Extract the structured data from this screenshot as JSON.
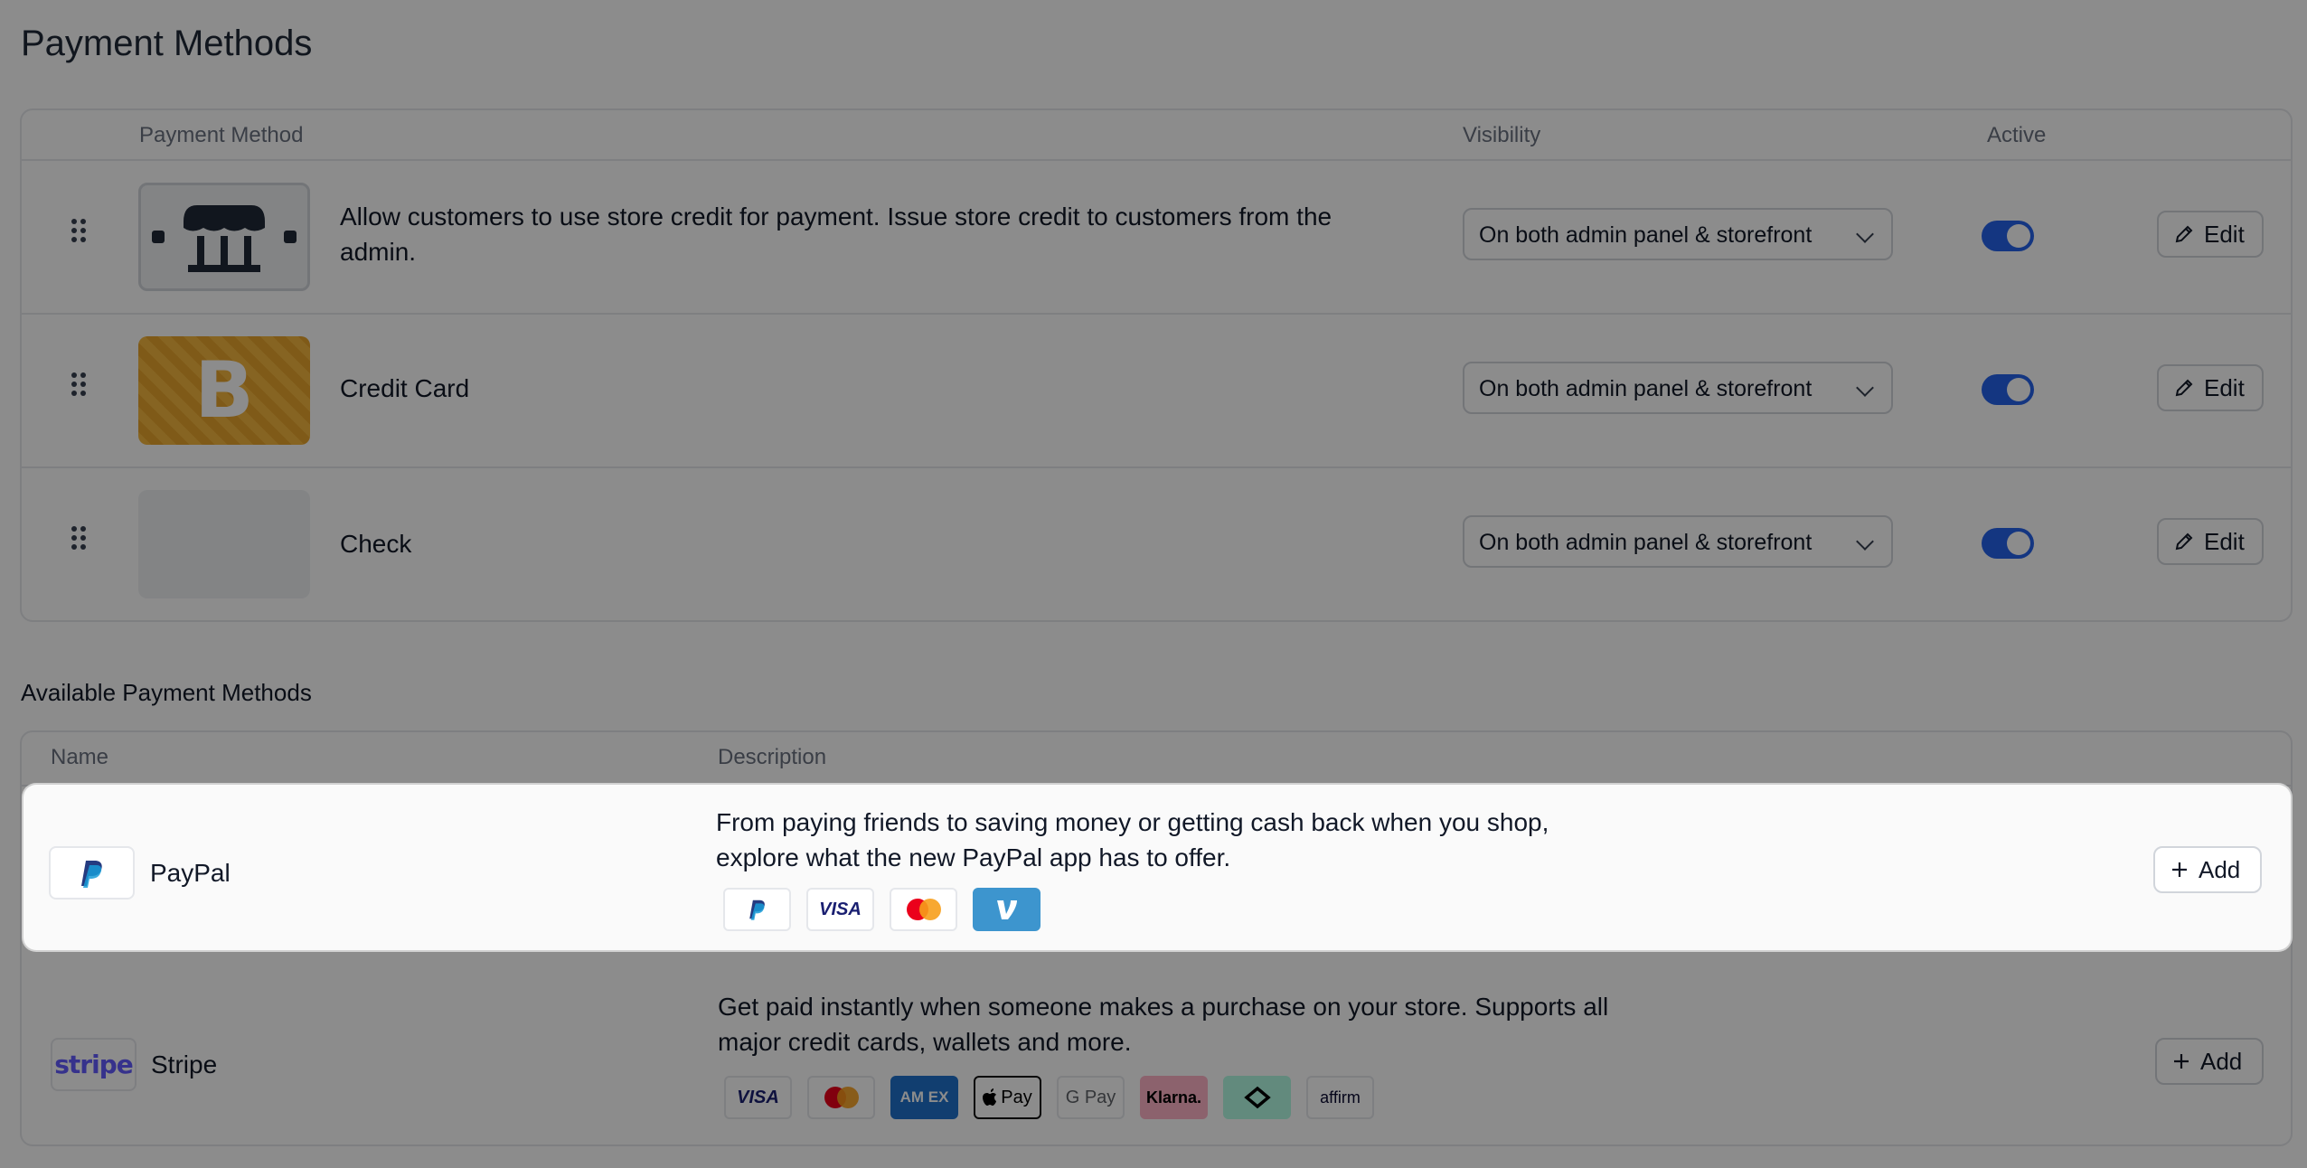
{
  "page_title": "Payment Methods",
  "methods_table": {
    "headers": {
      "method": "Payment Method",
      "visibility": "Visibility",
      "active": "Active"
    },
    "rows": [
      {
        "description": "Allow customers to use store credit for payment. Issue store credit to customers from the admin.",
        "logo": "store-icon",
        "visibility": "On both admin panel & storefront",
        "active": true,
        "edit_label": "Edit"
      },
      {
        "description": "Credit Card",
        "logo": "bold-b-logo",
        "logo_text": "B",
        "visibility": "On both admin panel & storefront",
        "active": true,
        "edit_label": "Edit"
      },
      {
        "description": "Check",
        "logo": "blank-logo",
        "visibility": "On both admin panel & storefront",
        "active": true,
        "edit_label": "Edit"
      }
    ]
  },
  "available": {
    "title": "Available Payment Methods",
    "headers": {
      "name": "Name",
      "description": "Description"
    },
    "rows": [
      {
        "name": "PayPal",
        "logo": "paypal-logo",
        "description": "From paying friends to saving money or getting cash back when you shop, explore what the new PayPal app has to offer.",
        "add_label": "Add",
        "brands": [
          "paypal",
          "visa",
          "mastercard",
          "venmo"
        ],
        "visa_text": "VISA"
      },
      {
        "name": "Stripe",
        "logo_text": "stripe",
        "description": "Get paid instantly when someone makes a purchase on your store. Supports all major credit cards, wallets and more.",
        "add_label": "Add",
        "brands": [
          "visa",
          "mastercard",
          "amex",
          "apple-pay",
          "google-pay",
          "klarna",
          "afterpay",
          "affirm"
        ],
        "visa_text": "VISA",
        "amex_text": "AM EX",
        "apple_text": "Pay",
        "gpay_text": "G Pay",
        "klarna_text": "Klarna.",
        "affirm_text": "affirm"
      }
    ]
  },
  "colors": {
    "accent": "#2563eb",
    "overlay": "rgba(0,0,0,0.45)"
  }
}
